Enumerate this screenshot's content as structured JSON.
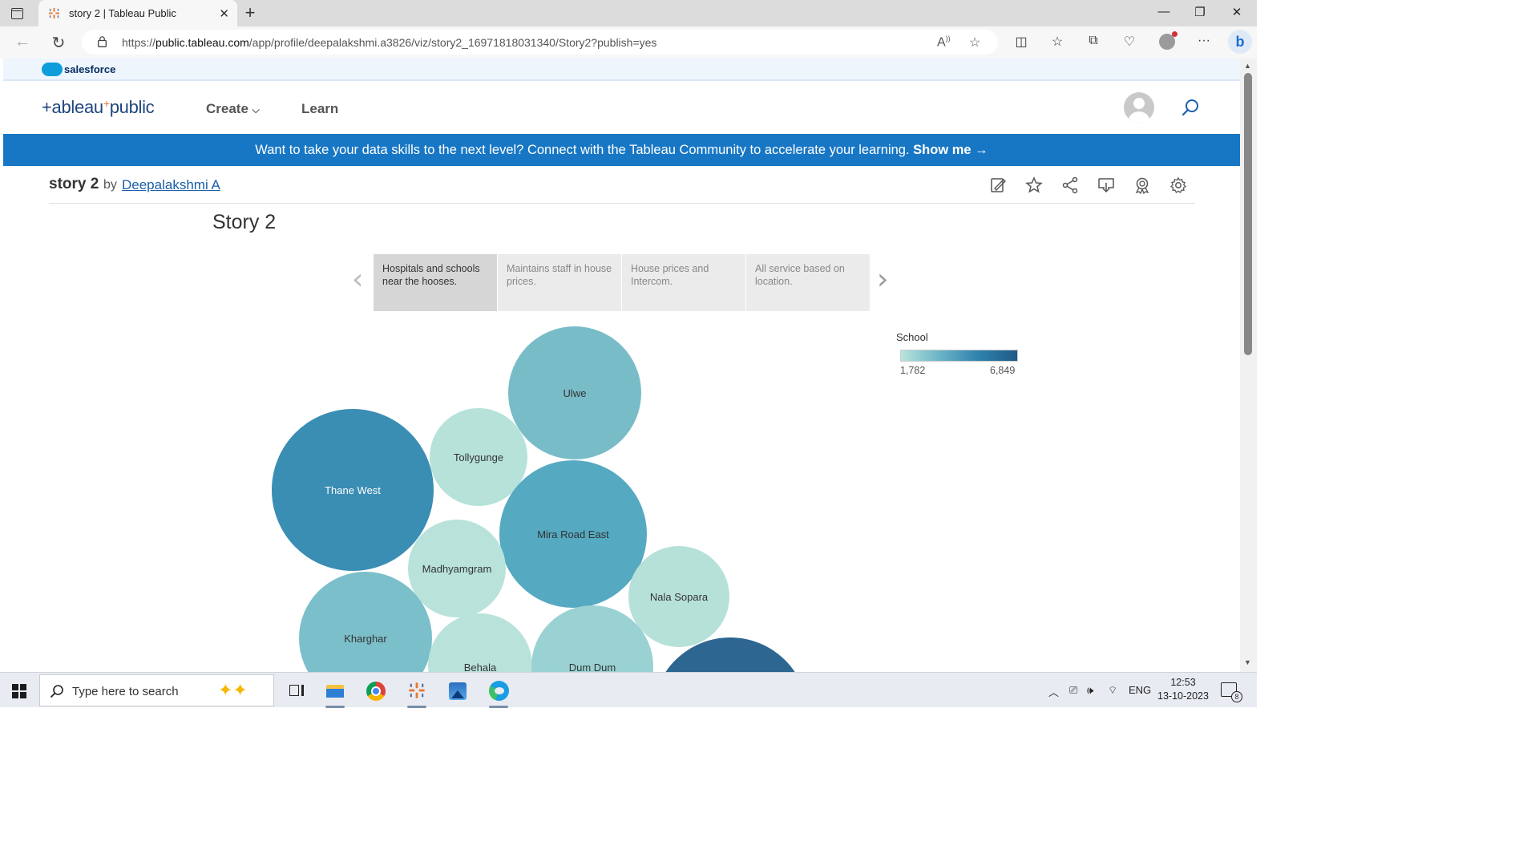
{
  "browser": {
    "tab_title": "story 2 | Tableau Public",
    "url_prefix": "https://",
    "url_host": "public.tableau.com",
    "url_path": "/app/profile/deepalakshmi.a3826/viz/story2_16971818031340/Story2?publish=yes"
  },
  "salesforce": {
    "label": "salesforce"
  },
  "nav": {
    "logo": "+ableau",
    "logo_suffix": "public",
    "create": "Create",
    "learn": "Learn"
  },
  "promo": {
    "text": "Want to take your data skills to the next level? Connect with the Tableau Community to accelerate your learning.",
    "cta": "Show me →"
  },
  "viz": {
    "title": "story 2",
    "by": "by",
    "author": "Deepalakshmi A"
  },
  "story": {
    "title": "Story 2",
    "points": [
      "Hospitals and schools near the hooses.",
      "Maintains staff in house prices.",
      "House  prices and Intercom.",
      "All service based on location."
    ],
    "active_index": 0
  },
  "legend": {
    "title": "School",
    "min": "1,782",
    "max": "6,849",
    "colors": [
      "#b9e4dd",
      "#6ab3c6",
      "#2f82ae",
      "#1e5a86"
    ]
  },
  "bubbles": [
    {
      "label": "Ulwe",
      "color": "#78bcc8"
    },
    {
      "label": "Thane West",
      "color": "#3a8db3"
    },
    {
      "label": "Tollygunge",
      "color": "#b7e2d9"
    },
    {
      "label": "Mira Road East",
      "color": "#55a9c1"
    },
    {
      "label": "Madhyamgram",
      "color": "#b9e3da"
    },
    {
      "label": "Nala Sopara",
      "color": "#b6e1d8"
    },
    {
      "label": "Kharghar",
      "color": "#7bbfca"
    },
    {
      "label": "Behala",
      "color": "#b9e3da"
    },
    {
      "label": "Dum Dum",
      "color": "#9ad2d3"
    },
    {
      "label": "",
      "color": "#2d6690"
    }
  ],
  "taskbar": {
    "search_placeholder": "Type here to search",
    "lang": "ENG",
    "time": "12:53",
    "date": "13-10-2023",
    "notifications": "8"
  }
}
